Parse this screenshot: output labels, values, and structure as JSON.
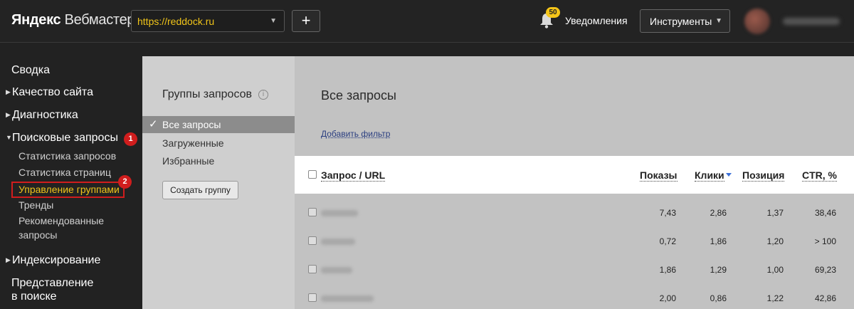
{
  "header": {
    "logo_brand": "Яндекс",
    "logo_product": "Вебмастер",
    "site": "https://reddock.ru",
    "add_label": "+",
    "notifications_count": "50",
    "notifications_label": "Уведомления",
    "tools_label": "Инструменты"
  },
  "sidebar": {
    "items": {
      "summary": "Сводка",
      "quality": "Качество сайта",
      "diagnostics": "Диагностика",
      "search_queries": "Поисковые запросы",
      "indexing": "Индексирование",
      "presentation_1": "Представление",
      "presentation_2": "в поиске"
    },
    "sub": {
      "query_stats": "Статистика запросов",
      "page_stats": "Статистика страниц",
      "group_mgmt": "Управление группами",
      "trends": "Тренды",
      "recommended_1": "Рекомендованные",
      "recommended_2": "запросы"
    },
    "marks": [
      "1",
      "2"
    ]
  },
  "groups": {
    "title": "Группы запросов",
    "info": "i",
    "items": [
      "Все запросы",
      "Загруженные",
      "Избранные"
    ],
    "check": "✓",
    "create_label": "Создать группу"
  },
  "main": {
    "title": "Все запросы",
    "add_filter": "Добавить фильтр",
    "columns": {
      "query": "Запрос / URL",
      "shows": "Показы",
      "clicks": "Клики",
      "position": "Позиция",
      "ctr": "CTR, %"
    },
    "rows": [
      {
        "shows": "7,43",
        "clicks": "2,86",
        "position": "1,37",
        "ctr": "38,46"
      },
      {
        "shows": "0,72",
        "clicks": "1,86",
        "position": "1,20",
        "ctr": "> 100"
      },
      {
        "shows": "1,86",
        "clicks": "1,29",
        "position": "1,00",
        "ctr": "69,23"
      },
      {
        "shows": "2,00",
        "clicks": "0,86",
        "position": "1,22",
        "ctr": "42,86"
      }
    ]
  },
  "colors": {
    "accent_yellow": "#f0c419",
    "highlight_red": "#d01d1d",
    "sort_blue": "#3a6fd8"
  }
}
